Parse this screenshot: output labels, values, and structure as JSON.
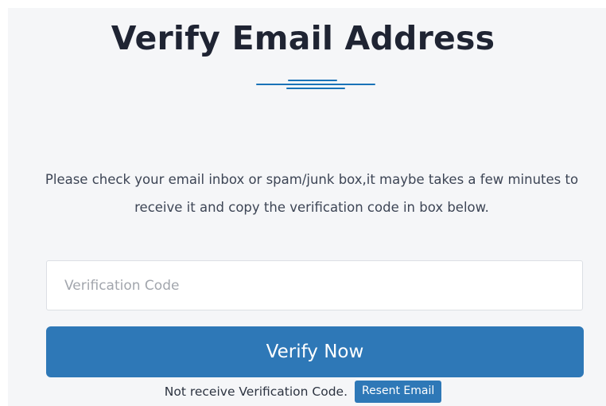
{
  "page": {
    "title": "Verify Email Address",
    "instructions": "Please check your email inbox or spam/junk box,it maybe takes a few minutes to receive it and copy the verification code in box below."
  },
  "form": {
    "code_placeholder": "Verification Code",
    "code_value": "",
    "submit_label": "Verify Now"
  },
  "resend": {
    "prompt": "Not receive Verification Code.",
    "button_label": "Resent Email"
  },
  "colors": {
    "accent": "#2e78b7",
    "divider": "#1a73b8",
    "title": "#1f2433",
    "background": "#f5f6f8"
  }
}
